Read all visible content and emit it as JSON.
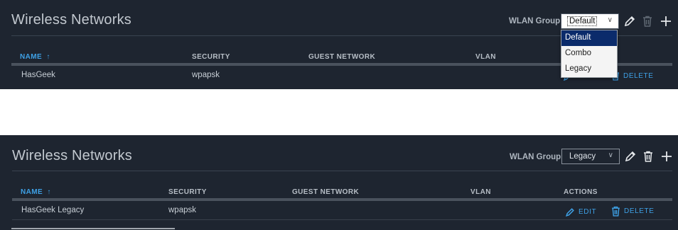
{
  "top": {
    "title": "Wireless Networks",
    "wlan_group_label": "WLAN Group",
    "select_value": "Default",
    "columns": [
      "NAME",
      "SECURITY",
      "GUEST NETWORK",
      "VLAN"
    ],
    "sort_arrow": "↑",
    "row": {
      "name": "HasGeek",
      "security": "wpapsk"
    },
    "delete_label": "DELETE",
    "dropdown_options": [
      "Default",
      "Combo",
      "Legacy"
    ]
  },
  "bottom": {
    "title": "Wireless Networks",
    "wlan_group_label": "WLAN Group",
    "select_value": "Legacy",
    "columns": [
      "NAME",
      "SECURITY",
      "GUEST NETWORK",
      "VLAN",
      "ACTIONS"
    ],
    "sort_arrow": "↑",
    "row": {
      "name": "HasGeek Legacy",
      "security": "wpapsk"
    },
    "edit_label": "EDIT",
    "delete_label": "DELETE"
  },
  "icons": {
    "edit": "pencil-icon",
    "delete": "trash-icon",
    "add": "plus-icon",
    "select": "chevron-down-icon"
  },
  "colors": {
    "panel_bg": "#1e2530",
    "accent": "#3ea1e6",
    "dropdown_selected": "#0b2b6b"
  }
}
